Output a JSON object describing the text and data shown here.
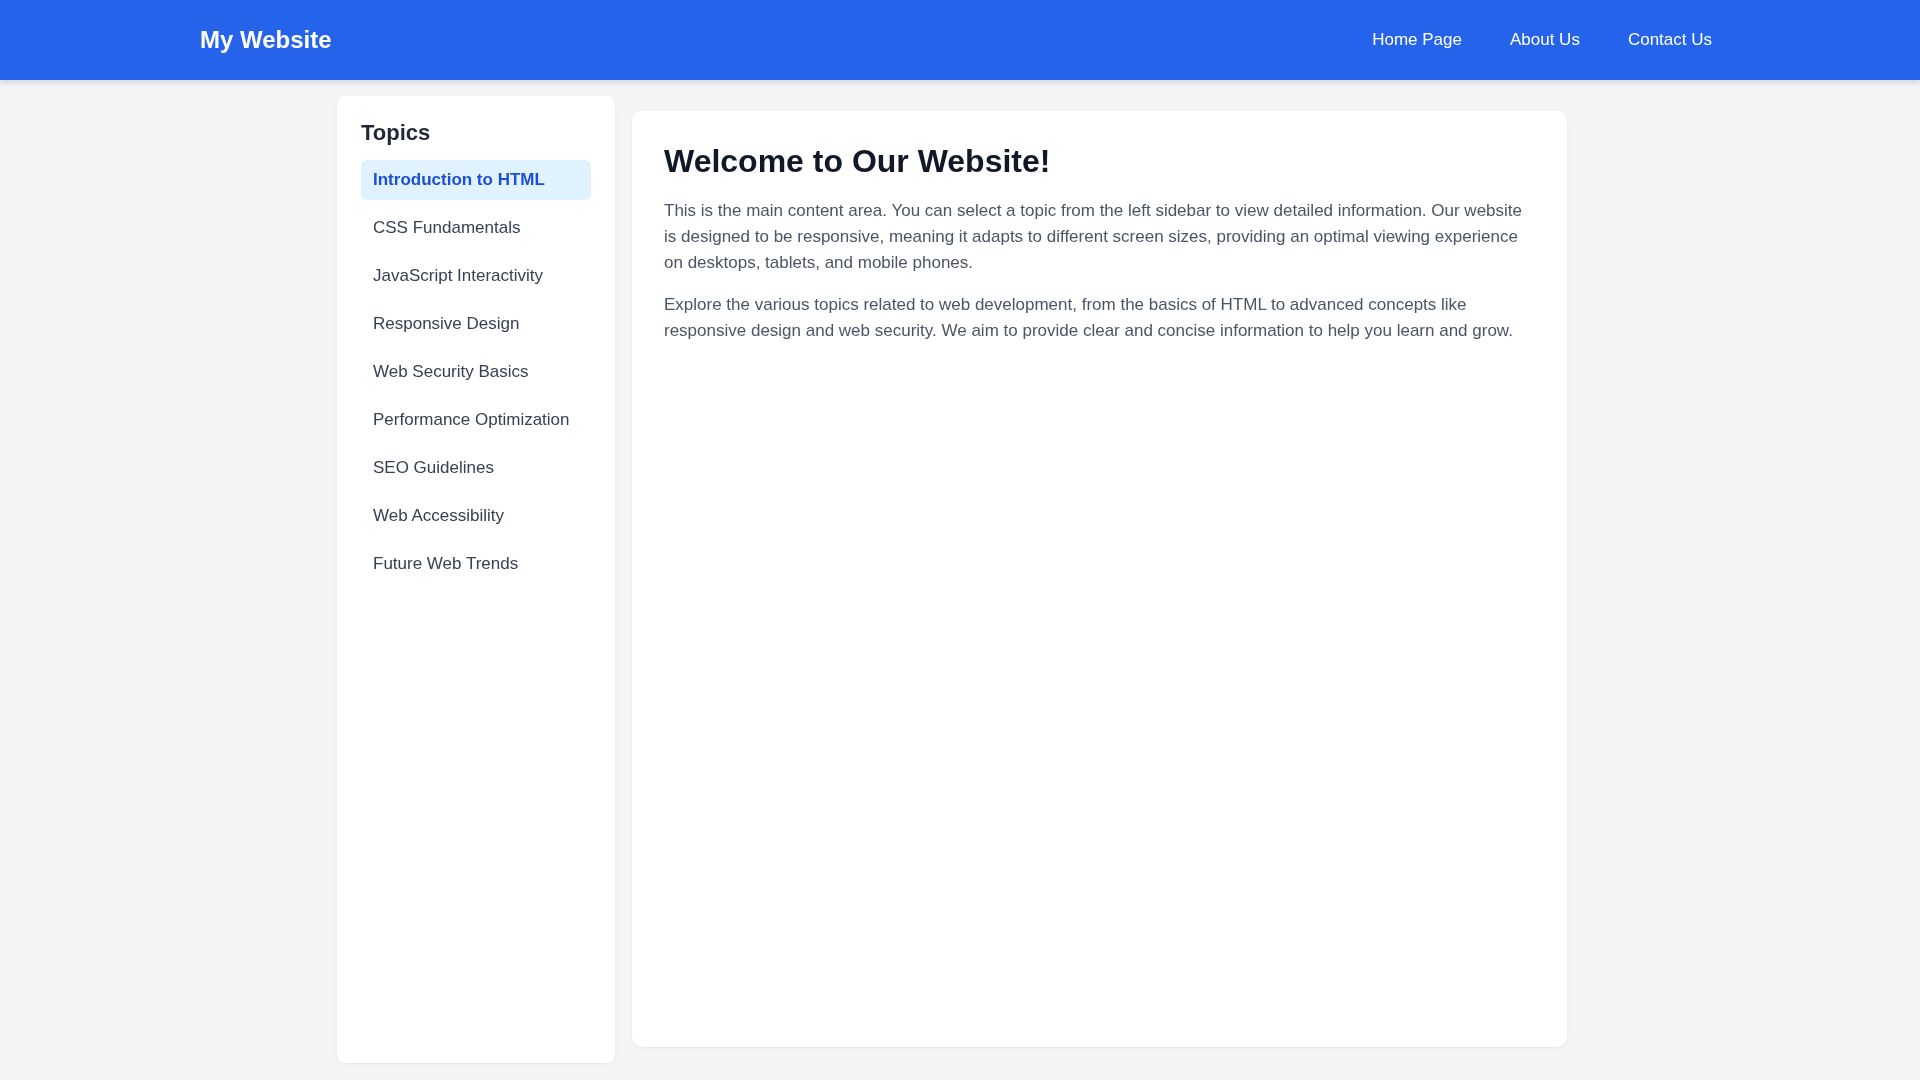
{
  "header": {
    "logo": "My Website",
    "nav": [
      {
        "label": "Home Page"
      },
      {
        "label": "About Us"
      },
      {
        "label": "Contact Us"
      }
    ]
  },
  "sidebar": {
    "title": "Topics",
    "items": [
      {
        "label": "Introduction to HTML",
        "selected": true
      },
      {
        "label": "CSS Fundamentals",
        "selected": false
      },
      {
        "label": "JavaScript Interactivity",
        "selected": false
      },
      {
        "label": "Responsive Design",
        "selected": false
      },
      {
        "label": "Web Security Basics",
        "selected": false
      },
      {
        "label": "Performance Optimization",
        "selected": false
      },
      {
        "label": "SEO Guidelines",
        "selected": false
      },
      {
        "label": "Web Accessibility",
        "selected": false
      },
      {
        "label": "Future Web Trends",
        "selected": false
      }
    ]
  },
  "main": {
    "title": "Welcome to Our Website!",
    "paragraphs": [
      "This is the main content area. You can select a topic from the left sidebar to view detailed information. Our website is designed to be responsive, meaning it adapts to different screen sizes, providing an optimal viewing experience on desktops, tablets, and mobile phones.",
      "Explore the various topics related to web development, from the basics of HTML to advanced concepts like responsive design and web security. We aim to provide clear and concise information to help you learn and grow."
    ]
  }
}
